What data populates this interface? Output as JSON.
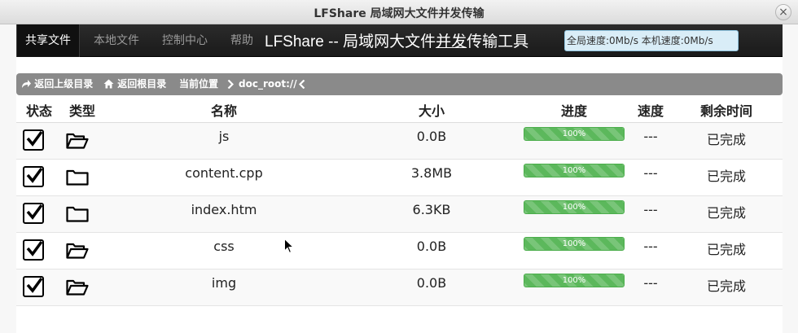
{
  "window": {
    "title": "LFShare 局域网大文件并发传输",
    "close_glyph": "×"
  },
  "nav": {
    "tabs": [
      {
        "label": "共享文件",
        "active": true
      },
      {
        "label": "本地文件",
        "active": false
      },
      {
        "label": "控制中心",
        "active": false
      },
      {
        "label": "帮助",
        "active": false
      }
    ],
    "brand_prefix": "LFShare -- 局域网大文件",
    "brand_underlined": "并发",
    "brand_suffix": "传输工具",
    "speed_text": "全局速度:0Mb/s 本机速度:0Mb/s"
  },
  "breadcrumb": {
    "up_label": "返回上级目录",
    "root_label": "返回根目录",
    "current_label": "当前位置",
    "path": "doc_root://"
  },
  "table": {
    "headers": {
      "status": "状态",
      "type": "类型",
      "name": "名称",
      "size": "大小",
      "progress": "进度",
      "speed": "速度",
      "remaining": "剩余时间"
    },
    "rows": [
      {
        "name": "js",
        "size": "0.0B",
        "progress": "100%",
        "speed": "---",
        "remaining": "已完成",
        "icon": "folder-open-icon"
      },
      {
        "name": "content.cpp",
        "size": "3.8MB",
        "progress": "100%",
        "speed": "---",
        "remaining": "已完成",
        "icon": "folder-icon"
      },
      {
        "name": "index.htm",
        "size": "6.3KB",
        "progress": "100%",
        "speed": "---",
        "remaining": "已完成",
        "icon": "folder-icon"
      },
      {
        "name": "css",
        "size": "0.0B",
        "progress": "100%",
        "speed": "---",
        "remaining": "已完成",
        "icon": "folder-open-icon"
      },
      {
        "name": "img",
        "size": "0.0B",
        "progress": "100%",
        "speed": "---",
        "remaining": "已完成",
        "icon": "folder-open-icon"
      }
    ]
  },
  "colors": {
    "progress": "#5cb85c",
    "navbar": "#1a1a1a",
    "breadcrumb": "#8a8a8a",
    "speed_box": "#d9edf7"
  }
}
